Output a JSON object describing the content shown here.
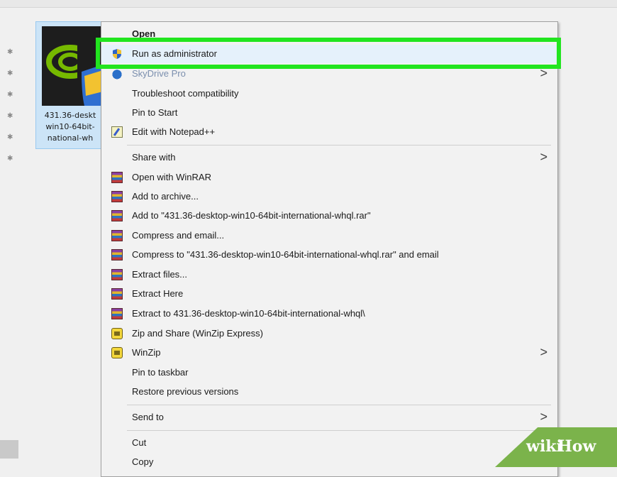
{
  "desktop_file": {
    "label_lines": [
      "431.36-deskt",
      "win10-64bit-",
      "national-wh"
    ]
  },
  "context_menu": {
    "items": [
      {
        "label": "Open"
      },
      {
        "label": "Run as administrator",
        "icon": "uac-shield-icon"
      },
      {
        "label": "SkyDrive Pro",
        "icon": "skydrive-icon",
        "submenu": true
      },
      {
        "label": "Troubleshoot compatibility"
      },
      {
        "label": "Pin to Start"
      },
      {
        "label": "Edit with Notepad++",
        "icon": "notepad-plus-plus-icon"
      },
      {
        "label": "Share with",
        "submenu": true
      },
      {
        "label": "Open with WinRAR",
        "icon": "winrar-icon"
      },
      {
        "label": "Add to archive...",
        "icon": "winrar-icon"
      },
      {
        "label": "Add to \"431.36-desktop-win10-64bit-international-whql.rar\"",
        "icon": "winrar-icon"
      },
      {
        "label": "Compress and email...",
        "icon": "winrar-icon"
      },
      {
        "label": "Compress to \"431.36-desktop-win10-64bit-international-whql.rar\" and email",
        "icon": "winrar-icon"
      },
      {
        "label": "Extract files...",
        "icon": "winrar-icon"
      },
      {
        "label": "Extract Here",
        "icon": "winrar-icon"
      },
      {
        "label": "Extract to 431.36-desktop-win10-64bit-international-whql\\",
        "icon": "winrar-icon"
      },
      {
        "label": "Zip and Share (WinZip Express)",
        "icon": "winzip-icon"
      },
      {
        "label": "WinZip",
        "icon": "winzip-icon",
        "submenu": true
      },
      {
        "label": "Pin to taskbar"
      },
      {
        "label": "Restore previous versions"
      },
      {
        "label": "Send to",
        "submenu": true
      },
      {
        "label": "Cut"
      },
      {
        "label": "Copy"
      }
    ],
    "submenu_arrow": ">"
  },
  "watermark": {
    "part1": "wiki",
    "part2": "How"
  },
  "colors": {
    "highlight_outline": "#22e51f",
    "menu_background": "#f2f2f2",
    "selection_background": "#cce4f7",
    "watermark_green": "#7bb34b"
  }
}
